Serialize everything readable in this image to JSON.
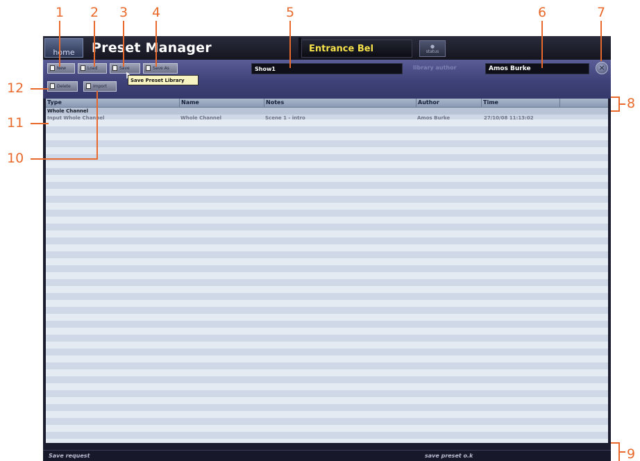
{
  "callouts": [
    "1",
    "2",
    "3",
    "4",
    "5",
    "6",
    "7",
    "8",
    "9",
    "10",
    "11",
    "12"
  ],
  "window": {
    "home_label": "home",
    "title": "Preset Manager",
    "show_name": "Entrance Bel",
    "status_label": "status",
    "status_glyph": "●"
  },
  "toolbar": {
    "buttons": [
      {
        "label": "New",
        "icon": "new-document-icon"
      },
      {
        "label": "Load",
        "icon": "load-icon"
      },
      {
        "label": "Save",
        "icon": "save-icon"
      },
      {
        "label": "Save As",
        "icon": "save-as-icon"
      },
      {
        "label": "Delete",
        "icon": "delete-icon"
      },
      {
        "label": "Import",
        "icon": "import-icon"
      }
    ],
    "tooltip": "Save Preset Library",
    "library_name": "Show1",
    "author_label": "library author",
    "author_value": "Amos Burke",
    "close_glyph": "×"
  },
  "table": {
    "columns": [
      "Type",
      "Name",
      "Notes",
      "Author",
      "Time"
    ],
    "group": "Whole Channel",
    "rows": [
      {
        "type": "Input Whole Channel",
        "name": "Whole Channel",
        "notes": "Scene 1 - intro",
        "author": "Amos Burke",
        "time": "27/10/08 11:13:02"
      }
    ]
  },
  "status_bar": {
    "left": "Save request",
    "right": "save preset o.k"
  },
  "colors": {
    "callout": "#e8692b",
    "show_name": "#f5e14a",
    "toolbar": "#4a4d85"
  }
}
